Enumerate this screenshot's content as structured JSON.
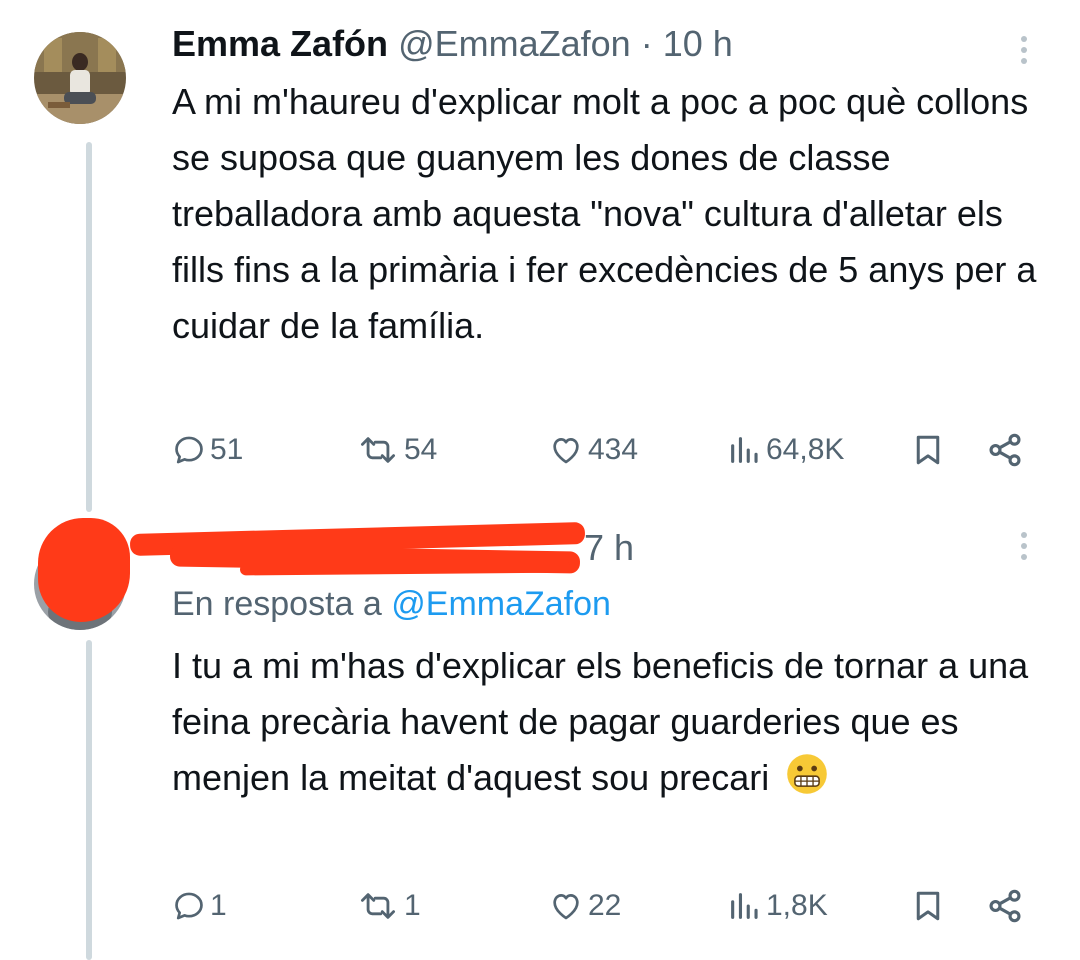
{
  "tweet1": {
    "name": "Emma Zafón",
    "handle": "@EmmaZafon",
    "separator": "·",
    "time": "10 h",
    "text": "A mi m'haureu d'explicar molt a poc a poc què collons se suposa que guanyem les dones de classe treballadora amb aquesta \"nova\" cultura d'alletar els fills fins a la primària i fer excedències de 5 anys per a cuidar de la família.",
    "replies": "51",
    "retweets": "54",
    "likes": "434",
    "views": "64,8K"
  },
  "tweet2": {
    "time": "7 h",
    "reply_prefix": "En resposta a",
    "reply_handle": "@EmmaZafon",
    "text": "I tu a mi m'has d'explicar els beneficis de tornar a una feina precària havent de pagar guarderies que es menjen la meitat d'aquest sou precari",
    "emoji": "grimacing-face",
    "replies": "1",
    "retweets": "1",
    "likes": "22",
    "views": "1,8K"
  },
  "icons": [
    "reply-icon",
    "retweet-icon",
    "like-icon",
    "views-icon",
    "bookmark-icon",
    "share-icon",
    "more-icon"
  ],
  "colors": {
    "text": "#0f1419",
    "secondary": "#536471",
    "link": "#1d9bf0",
    "thread_line": "#cfd9de",
    "redaction": "#ff3a18"
  }
}
